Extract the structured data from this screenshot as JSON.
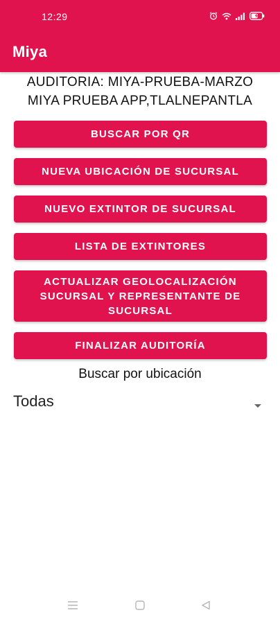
{
  "status_bar": {
    "time": "12:29",
    "battery_level": "charging",
    "icons": [
      "alarm-icon",
      "wifi-icon",
      "signal-icon",
      "battery-icon"
    ]
  },
  "app_bar": {
    "title": "Miya"
  },
  "header": {
    "audit_line": "AUDITORIA: MIYA-PRUEBA-MARZO",
    "branch_line": "MIYA PRUEBA APP,TLALNEPANTLA"
  },
  "actions": {
    "scan_qr": "BUSCAR POR QR",
    "new_location": "NUEVA UBICACIÓN DE SUCURSAL",
    "new_extinguisher": "NUEVO EXTINTOR DE SUCURSAL",
    "extinguisher_list": "LISTA DE EXTINTORES",
    "update_geo_line1": "ACTUALIZAR GEOLOCALIZACIÓN",
    "update_geo_line2": "SUCURSAL Y REPRESENTANTE DE",
    "update_geo_line3": "SUCURSAL",
    "finish_audit": "FINALIZAR AUDITORÍA"
  },
  "location_filter": {
    "label": "Buscar por ubicación",
    "selected": "Todas"
  },
  "colors": {
    "primary": "#e0134f",
    "on_primary": "#ffffff",
    "text": "#111111"
  }
}
